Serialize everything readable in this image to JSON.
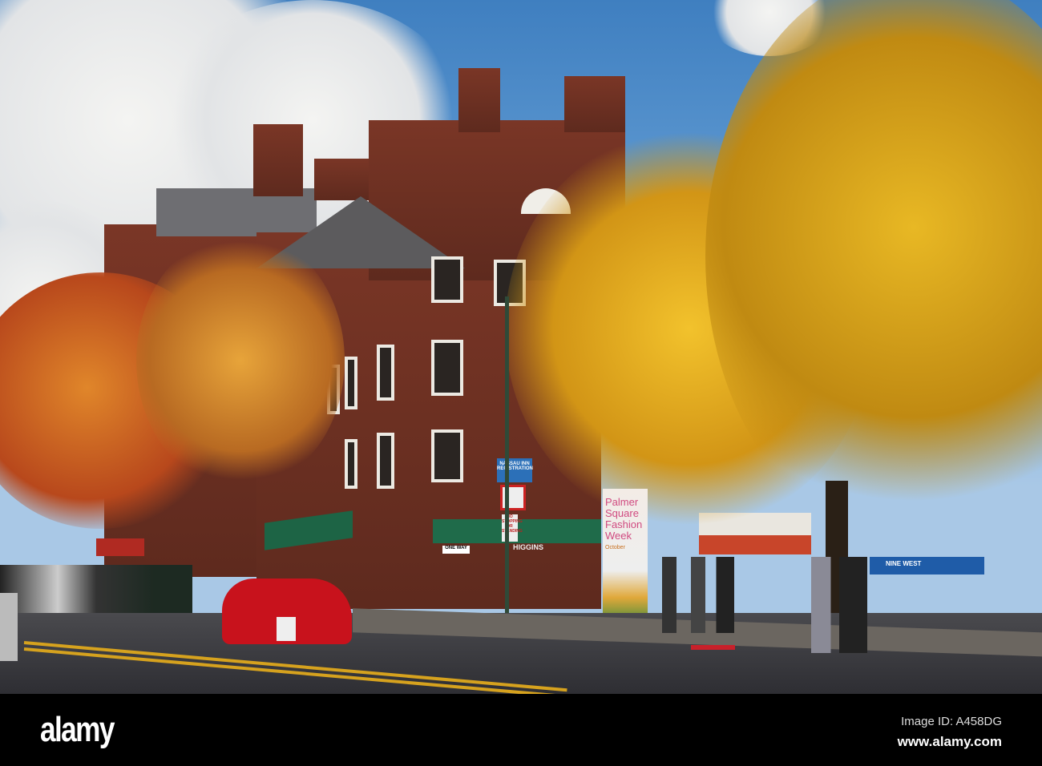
{
  "photo": {
    "signs": {
      "inn": "NASSAU INN REGISTRATION",
      "no_stopping": "NO STOPPING OR STANDING",
      "one_way": "ONE WAY",
      "banner": "Palmer Square Fashion Week",
      "banner_date": "October",
      "store": "HIGGINS",
      "store2": "NINE WEST"
    }
  },
  "watermark": {
    "logo": "alamy",
    "image_id": "Image ID: A458DG",
    "site": "www.alamy.com"
  }
}
